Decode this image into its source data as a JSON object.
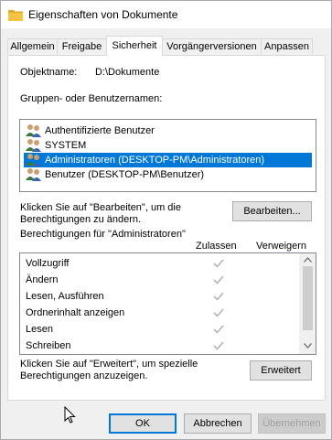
{
  "window": {
    "title": "Eigenschaften von Dokumente",
    "icon": "folder-icon"
  },
  "tabs": [
    {
      "label": "Allgemein"
    },
    {
      "label": "Freigabe"
    },
    {
      "label": "Sicherheit",
      "active": true
    },
    {
      "label": "Vorgängerversionen"
    },
    {
      "label": "Anpassen"
    }
  ],
  "security": {
    "object_label": "Objektname:",
    "object_value": "D:\\Dokumente",
    "groups_label": "Gruppen- oder Benutzernamen:",
    "groups": [
      {
        "name": "Authentifizierte Benutzer",
        "icon": "users-icon"
      },
      {
        "name": "SYSTEM",
        "icon": "users-icon"
      },
      {
        "name": "Administratoren (DESKTOP-PM\\Administratoren)",
        "icon": "users-icon",
        "selected": true
      },
      {
        "name": "Benutzer (DESKTOP-PM\\Benutzer)",
        "icon": "users-icon"
      }
    ],
    "edit_hint_line1": "Klicken Sie auf \"Bearbeiten\", um die",
    "edit_hint_line2": "Berechtigungen zu ändern.",
    "edit_button": "Bearbeiten...",
    "permissions_for": "Berechtigungen für \"Administratoren\"",
    "col_allow": "Zulassen",
    "col_deny": "Verweigern",
    "permissions": [
      {
        "name": "Vollzugriff",
        "allow": true,
        "deny": false
      },
      {
        "name": "Ändern",
        "allow": true,
        "deny": false
      },
      {
        "name": "Lesen, Ausführen",
        "allow": true,
        "deny": false
      },
      {
        "name": "Ordnerinhalt anzeigen",
        "allow": true,
        "deny": false
      },
      {
        "name": "Lesen",
        "allow": true,
        "deny": false
      },
      {
        "name": "Schreiben",
        "allow": true,
        "deny": false
      }
    ],
    "advanced_hint_line1": "Klicken Sie auf \"Erweitert\", um spezielle",
    "advanced_hint_line2": "Berechtigungen anzuzeigen.",
    "advanced_button": "Erweitert"
  },
  "footer": {
    "ok": "OK",
    "cancel": "Abbrechen",
    "apply": "Übernehmen"
  },
  "colors": {
    "selection": "#0078d7",
    "check_disabled": "#b4b4b4",
    "folder": "#f5c342"
  }
}
